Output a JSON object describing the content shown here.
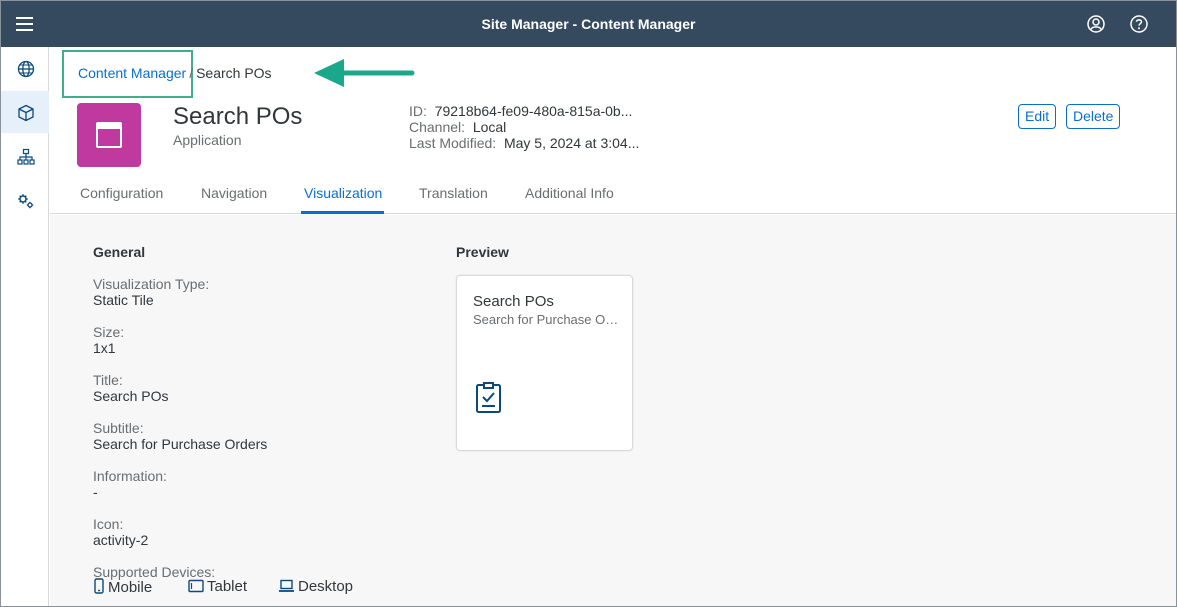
{
  "shell": {
    "title": "Site Manager - Content Manager",
    "menu_icon": "hamburger-menu-icon",
    "actions": [
      "user-account-icon",
      "help-icon"
    ]
  },
  "sidenav": {
    "items": [
      {
        "icon": "globe-icon",
        "selected": false
      },
      {
        "icon": "cube-icon",
        "selected": true
      },
      {
        "icon": "sitemap-icon",
        "selected": false
      },
      {
        "icon": "settings-gears-icon",
        "selected": false
      }
    ]
  },
  "breadcrumb": {
    "link": "Content Manager",
    "separator": "/",
    "current": "Search POs"
  },
  "object": {
    "title": "Search POs",
    "subtitle": "Application",
    "icon": "application-window-icon",
    "icon_color": "#c0399f"
  },
  "attributes": [
    {
      "label": "ID:",
      "value": "79218b64-fe09-480a-815a-0b..."
    },
    {
      "label": "Channel:",
      "value": "Local"
    },
    {
      "label": "Last Modified:",
      "value": "May 5, 2024 at 3:04..."
    }
  ],
  "buttons": {
    "edit": "Edit",
    "delete": "Delete"
  },
  "tabs": [
    {
      "label": "Configuration",
      "active": false
    },
    {
      "label": "Navigation",
      "active": false
    },
    {
      "label": "Visualization",
      "active": true
    },
    {
      "label": "Translation",
      "active": false
    },
    {
      "label": "Additional Info",
      "active": false
    }
  ],
  "general": {
    "title": "General",
    "fields": [
      {
        "label": "Visualization Type:",
        "value": "Static Tile"
      },
      {
        "label": "Size:",
        "value": "1x1"
      },
      {
        "label": "Title:",
        "value": "Search POs"
      },
      {
        "label": "Subtitle:",
        "value": "Search for Purchase Orders"
      },
      {
        "label": "Information:",
        "value": "-"
      },
      {
        "label": "Icon:",
        "value": "activity-2"
      }
    ],
    "devices_label": "Supported Devices:",
    "devices": [
      {
        "label": "Mobile",
        "icon": "mobile-icon"
      },
      {
        "label": "Tablet",
        "icon": "tablet-icon"
      },
      {
        "label": "Desktop",
        "icon": "laptop-icon"
      }
    ]
  },
  "preview": {
    "title": "Preview",
    "tile_title": "Search POs",
    "tile_subtitle": "Search for Purchase Orders",
    "tile_icon": "clipboard-check-icon"
  },
  "colors": {
    "shell": "#354a5f",
    "accent": "#0a6ed1",
    "highlight_box": "#3fae8a",
    "arrow": "#1aa88a"
  }
}
